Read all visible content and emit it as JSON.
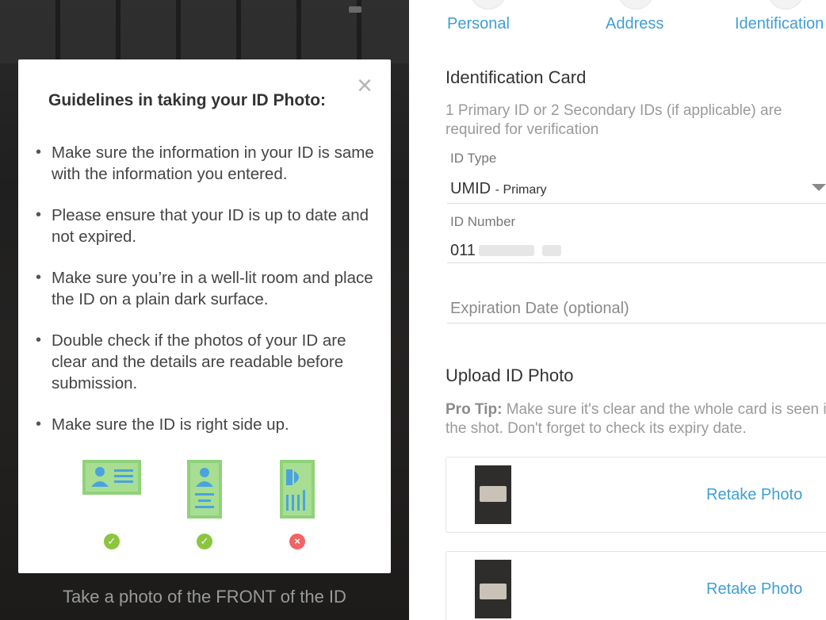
{
  "camera": {
    "caption": "Take a photo of the FRONT of the ID"
  },
  "modal": {
    "close_icon": "×",
    "title": "Guidelines in taking your ID Photo:",
    "guidelines": [
      "Make sure the information in your ID is same with the information you entered.",
      "Please ensure that your ID is up to date and not expired.",
      "Make sure you’re in a well-lit room and place the ID on a plain dark surface.",
      "Double check if the photos of your ID are clear and the details are readable before submission.",
      "Make sure the ID is right side up."
    ],
    "examples": [
      {
        "icon": "id-landscape-icon",
        "status": "✓"
      },
      {
        "icon": "id-portrait-icon",
        "status": "✓"
      },
      {
        "icon": "id-rotated-icon",
        "status": "×"
      }
    ]
  },
  "form": {
    "steps": [
      {
        "label": "Personal"
      },
      {
        "label": "Address"
      },
      {
        "label": "Identification"
      }
    ],
    "identification": {
      "title": "Identification Card",
      "subtitle": "1 Primary ID or 2 Secondary IDs (if applicable) are required for verification",
      "id_type_label": "ID Type",
      "id_type_value": "UMID",
      "id_type_suffix": "- Primary",
      "id_number_label": "ID Number",
      "id_number_value": "011",
      "expiration_placeholder": "Expiration Date (optional)"
    },
    "upload": {
      "title": "Upload ID Photo",
      "tip_prefix": "Pro Tip:",
      "tip_text": " Make sure it's clear and the whole card is seen in the shot. Don't forget to check its expiry date.",
      "photos": [
        {
          "action": "Retake Photo"
        },
        {
          "action": "Retake Photo"
        }
      ]
    }
  },
  "colors": {
    "accent": "#3f9fd2",
    "ok": "#8cc63f",
    "bad": "#f06464",
    "illustration": "#8fd27a",
    "illustration_blue": "#4aa3df"
  }
}
